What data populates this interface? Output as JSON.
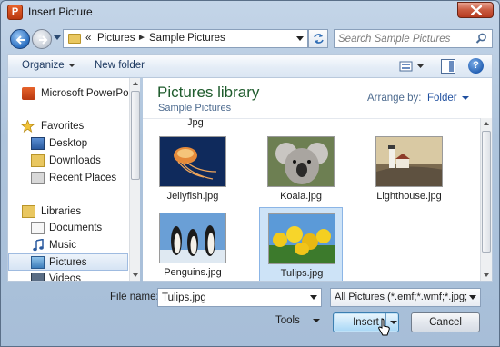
{
  "window": {
    "title": "Insert Picture",
    "app_icon_letter": "P"
  },
  "address": {
    "overflow": "«",
    "breadcrumbs": [
      "Pictures",
      "Sample Pictures"
    ],
    "separator": "►"
  },
  "search": {
    "placeholder": "Search Sample Pictures"
  },
  "toolbar": {
    "organize_label": "Organize",
    "new_folder_label": "New folder",
    "help_label": "?"
  },
  "nav": {
    "items": [
      {
        "label": "Microsoft PowerPoin",
        "icon": "powerpoint-icon"
      },
      {
        "label": "Favorites",
        "icon": "star-icon"
      },
      {
        "label": "Desktop",
        "icon": "desktop-icon"
      },
      {
        "label": "Downloads",
        "icon": "downloads-folder-icon"
      },
      {
        "label": "Recent Places",
        "icon": "recent-places-icon"
      },
      {
        "label": "Libraries",
        "icon": "libraries-icon"
      },
      {
        "label": "Documents",
        "icon": "documents-icon"
      },
      {
        "label": "Music",
        "icon": "music-icon"
      },
      {
        "label": "Pictures",
        "icon": "pictures-icon",
        "selected": true
      },
      {
        "label": "Videos",
        "icon": "videos-icon"
      }
    ]
  },
  "content": {
    "library_title": "Pictures library",
    "library_subtitle": "Sample Pictures",
    "arrange_by_label": "Arrange by:",
    "arrange_by_value": "Folder",
    "cut_off_label": "Jpg",
    "files": [
      {
        "name": "Jellyfish.jpg"
      },
      {
        "name": "Koala.jpg"
      },
      {
        "name": "Lighthouse.jpg"
      },
      {
        "name": "Penguins.jpg"
      },
      {
        "name": "Tulips.jpg",
        "selected": true
      }
    ]
  },
  "footer": {
    "file_name_label": "File name:",
    "file_name_value": "Tulips.jpg",
    "filter_value": "All Pictures (*.emf;*.wmf;*.jpg;*",
    "tools_label": "Tools",
    "insert_label": "Insert",
    "cancel_label": "Cancel"
  },
  "colors": {
    "library_title": "#1e5b2c",
    "link_blue": "#1f4f9f",
    "selection": "#cde3f7"
  }
}
